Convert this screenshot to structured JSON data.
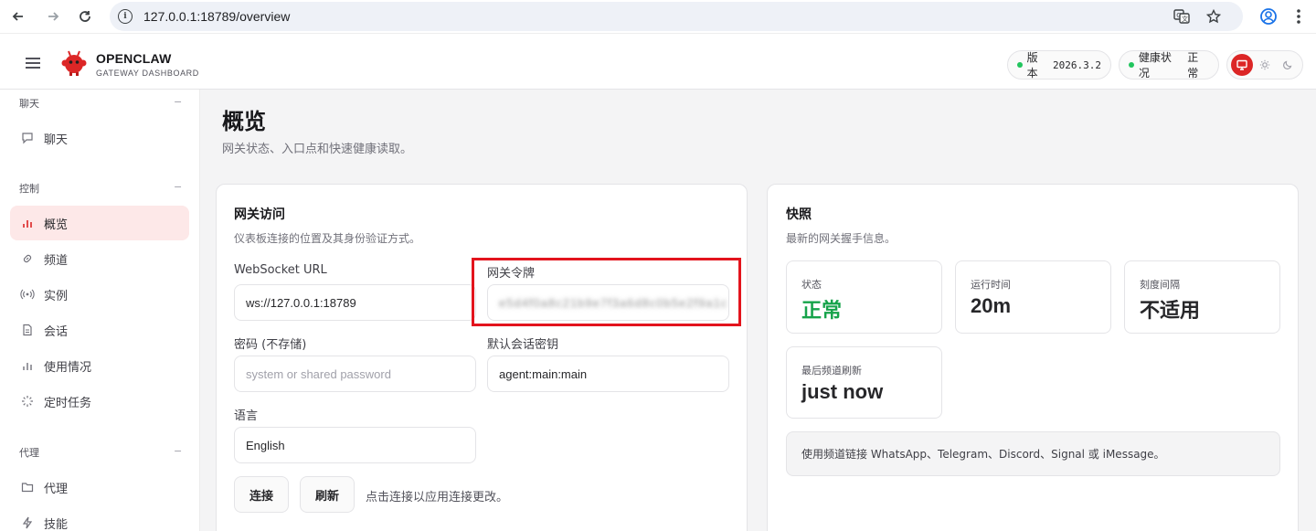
{
  "browser": {
    "url": "127.0.0.1:18789/overview"
  },
  "header": {
    "brand_title": "OPENCLAW",
    "brand_subtitle": "GATEWAY DASHBOARD",
    "version_label": "版本",
    "version_value": "2026.3.2",
    "health_label": "健康状况",
    "health_value": "正常"
  },
  "sidebar": {
    "sections": [
      {
        "label": "聊天",
        "collapse": "−",
        "items": [
          {
            "label": "聊天",
            "icon": "chat-icon"
          }
        ]
      },
      {
        "label": "控制",
        "collapse": "−",
        "items": [
          {
            "label": "概览",
            "icon": "bar-chart-icon",
            "active": true
          },
          {
            "label": "频道",
            "icon": "link-icon"
          },
          {
            "label": "实例",
            "icon": "broadcast-icon"
          },
          {
            "label": "会话",
            "icon": "document-icon"
          },
          {
            "label": "使用情况",
            "icon": "bar-chart-icon"
          },
          {
            "label": "定时任务",
            "icon": "loader-icon"
          }
        ]
      },
      {
        "label": "代理",
        "collapse": "−",
        "items": [
          {
            "label": "代理",
            "icon": "folder-icon"
          },
          {
            "label": "技能",
            "icon": "lightning-icon"
          }
        ]
      }
    ]
  },
  "page": {
    "title": "概览",
    "subtitle": "网关状态、入口点和快速健康读取。"
  },
  "access_card": {
    "title": "网关访问",
    "subtitle": "仪表板连接的位置及其身份验证方式。",
    "websocket_label": "WebSocket URL",
    "websocket_value": "ws://127.0.0.1:18789",
    "token_label": "网关令牌",
    "token_value": "e5d4f0a8c21b9e7f3a6d8c0b5e2f9a1c",
    "password_label": "密码 (不存储)",
    "password_placeholder": "system or shared password",
    "session_key_label": "默认会话密钥",
    "session_key_value": "agent:main:main",
    "language_label": "语言",
    "language_value": "English",
    "connect_label": "连接",
    "refresh_label": "刷新",
    "hint": "点击连接以应用连接更改。"
  },
  "snapshot_card": {
    "title": "快照",
    "subtitle": "最新的网关握手信息。",
    "stats": [
      {
        "label": "状态",
        "value": "正常"
      },
      {
        "label": "运行时间",
        "value": "20m"
      },
      {
        "label": "刻度间隔",
        "value": "不适用"
      },
      {
        "label": "最后频道刷新",
        "value": "just now"
      }
    ],
    "notice": "使用频道链接 WhatsApp、Telegram、Discord、Signal 或 iMessage。"
  },
  "colors": {
    "accent": "#dc2626",
    "ok": "#16a34a",
    "highlight_box": "#e3141d"
  }
}
